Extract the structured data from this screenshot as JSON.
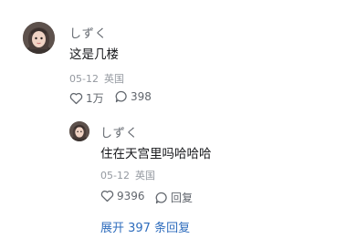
{
  "comment": {
    "username": "しずく",
    "text": "这是几楼",
    "date": "05-12",
    "location": "英国",
    "like_count": "1万",
    "reply_count": "398",
    "avatar_icon": "user-avatar"
  },
  "reply": {
    "username": "しずく",
    "text": "住在天宫里吗哈哈哈",
    "date": "05-12",
    "location": "英国",
    "like_count": "9396",
    "reply_label": "回复",
    "avatar_icon": "user-avatar"
  },
  "expand_replies": {
    "label": "展开 397 条回复"
  },
  "colors": {
    "link": "#2f6dbd",
    "meta": "#9499a0",
    "text": "#18191c",
    "username": "#61666d"
  }
}
